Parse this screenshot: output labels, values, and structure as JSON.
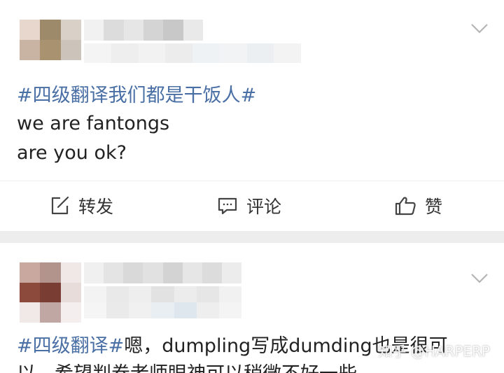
{
  "posts": [
    {
      "hashtag": "#四级翻译我们都是干饭人#",
      "lines": [
        "we are fantongs",
        "are you ok?"
      ],
      "actions": {
        "repost_label": "转发",
        "comment_label": "评论",
        "like_label": "赞"
      }
    },
    {
      "hashtag": "#四级翻译#",
      "line1_rest": "嗯，dumpling写成dumding也是很可",
      "line2": "以，希望判卷老师眼神可以稍微不好一些"
    }
  ],
  "watermark": "知乎 @HARPERP",
  "icons": [
    "chevron-down-icon",
    "repost-icon",
    "comment-icon",
    "thumbs-up-icon"
  ],
  "colors": {
    "hashtag": "#4a6fa5",
    "text": "#222222",
    "separator": "#ededed"
  }
}
